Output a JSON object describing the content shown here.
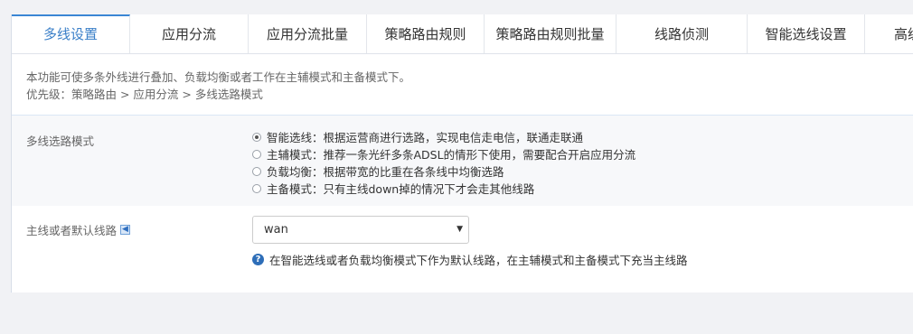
{
  "tabs": [
    {
      "label": "多线设置",
      "active": true
    },
    {
      "label": "应用分流"
    },
    {
      "label": "应用分流批量"
    },
    {
      "label": "策略路由规则"
    },
    {
      "label": "策略路由规则批量"
    },
    {
      "label": "线路侦测"
    },
    {
      "label": "智能选线设置"
    },
    {
      "label": "高级"
    }
  ],
  "description": {
    "line1": "本功能可使多条外线进行叠加、负载均衡或者工作在主辅模式和主备模式下。",
    "line2": "优先级：策略路由 > 应用分流 > 多线选路模式"
  },
  "mode_section": {
    "label": "多线选路模式",
    "options": [
      {
        "text": "智能选线：根据运营商进行选路，实现电信走电信，联通走联通",
        "checked": true
      },
      {
        "text": "主辅模式：推荐一条光纤多条ADSL的情形下使用，需要配合开启应用分流",
        "checked": false
      },
      {
        "text": "负载均衡：根据带宽的比重在各条线中均衡选路",
        "checked": false
      },
      {
        "text": "主备模式：只有主线down掉的情况下才会走其他线路",
        "checked": false
      }
    ]
  },
  "default_line": {
    "label": "主线或者默认线路",
    "info_icon": "info-icon",
    "select_value": "wan",
    "help_text": "在智能选线或者负载均衡模式下作为默认线路，在主辅模式和主备模式下充当主线路"
  },
  "colors": {
    "accent": "#3a7fc8",
    "help_icon": "#2e6eb8",
    "background": "#f1f2f5"
  }
}
